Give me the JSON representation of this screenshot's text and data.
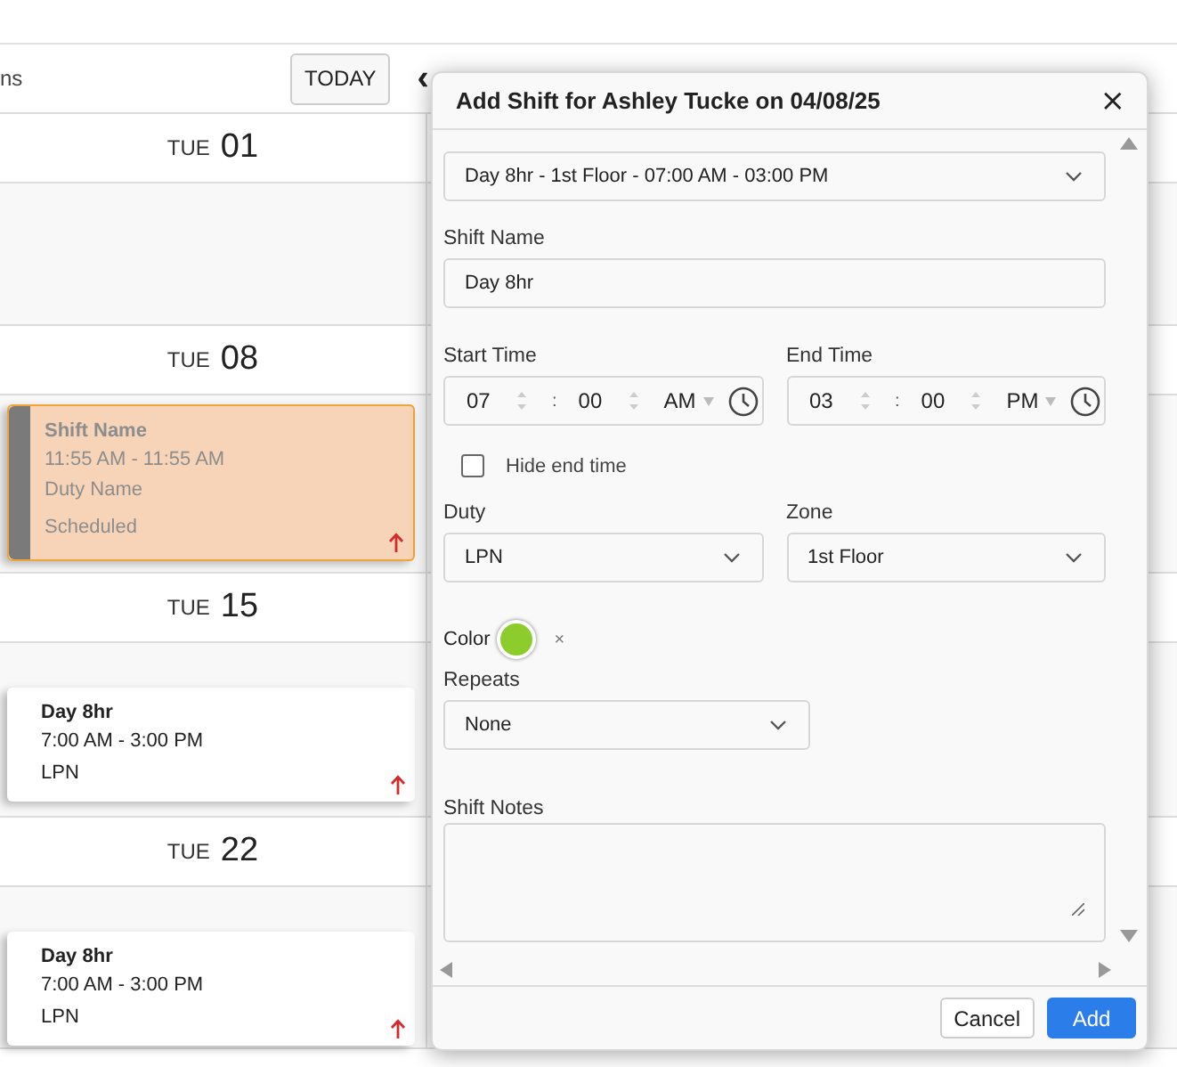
{
  "toolbar": {
    "view_label": "ns",
    "today_button": "TODAY",
    "prev": "‹"
  },
  "days": [
    {
      "weekday": "TUE",
      "date": "01"
    },
    {
      "weekday": "TUE",
      "date": "08",
      "shifts": [
        {
          "kind": "draft",
          "name": "Shift Name",
          "time": "11:55 AM - 11:55 AM",
          "duty": "Duty Name",
          "status": "Scheduled"
        }
      ]
    },
    {
      "weekday": "TUE",
      "date": "15",
      "shifts": [
        {
          "kind": "assigned",
          "name": "Day 8hr",
          "time": "7:00 AM - 3:00 PM",
          "duty": "LPN"
        }
      ]
    },
    {
      "weekday": "TUE",
      "date": "22",
      "shifts": [
        {
          "kind": "assigned",
          "name": "Day 8hr",
          "time": "7:00 AM - 3:00 PM",
          "duty": "LPN"
        }
      ]
    }
  ],
  "dialog": {
    "title": "Add Shift for Ashley Tucke on 04/08/25",
    "close": "×",
    "template": {
      "value": "Day 8hr - 1st Floor - 07:00 AM - 03:00 PM"
    },
    "shift_name": {
      "label": "Shift Name",
      "value": "Day 8hr"
    },
    "times": [
      {
        "label": "Start Time",
        "hour": "07",
        "separator": ":",
        "minute": "00",
        "period": "AM"
      },
      {
        "label": "End Time",
        "hour": "03",
        "separator": ":",
        "minute": "00",
        "period": "PM"
      }
    ],
    "hide_end_time": {
      "label": "Hide end time",
      "checked": false
    },
    "selects": [
      {
        "label": "Duty",
        "value": "LPN"
      },
      {
        "label": "Zone",
        "value": "1st Floor"
      }
    ],
    "color": {
      "label": "Color",
      "color": "#8ccc2c",
      "clear": "×"
    },
    "repeats": {
      "label": "Repeats",
      "value": "None"
    },
    "notes": {
      "label": "Shift Notes"
    },
    "buttons": [
      {
        "label": "Cancel",
        "primary": false
      },
      {
        "label": "Add",
        "primary": true
      }
    ]
  }
}
